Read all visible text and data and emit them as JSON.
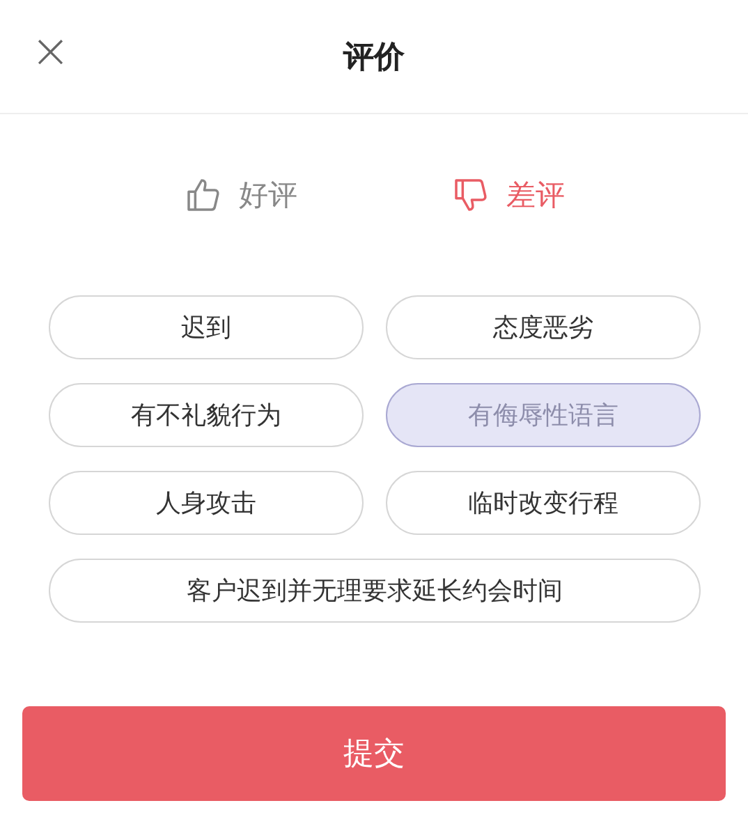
{
  "header": {
    "close_icon": "×",
    "title": "评价"
  },
  "ratings": [
    {
      "label": "好评",
      "kind": "up",
      "selected": false
    },
    {
      "label": "差评",
      "kind": "down",
      "selected": true
    }
  ],
  "tags": [
    {
      "label": "迟到",
      "selected": false
    },
    {
      "label": "态度恶劣",
      "selected": false
    },
    {
      "label": "有不礼貌行为",
      "selected": false
    },
    {
      "label": "有侮辱性语言",
      "selected": true
    },
    {
      "label": "人身攻击",
      "selected": false
    },
    {
      "label": "临时改变行程",
      "selected": false
    },
    {
      "label": "客户迟到并无理要求延长约会时间",
      "selected": false
    }
  ],
  "submit_button": "提交"
}
